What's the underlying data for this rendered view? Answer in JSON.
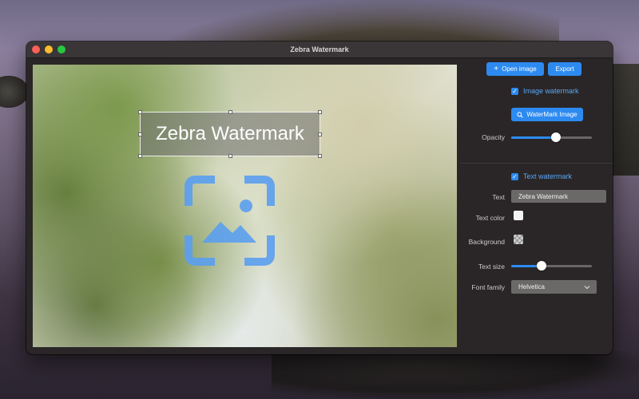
{
  "window": {
    "title": "Zebra Watermark"
  },
  "toolbar": {
    "open_image_label": "Open image",
    "export_label": "Export"
  },
  "image_watermark": {
    "enabled": true,
    "label": "Image watermark",
    "button_label": "WaterMark Image"
  },
  "opacity": {
    "label": "Opacity",
    "value": 0.55
  },
  "text_watermark": {
    "enabled": true,
    "label": "Text watermark",
    "text_label": "Text",
    "text_value": "Zebra Watermark",
    "text_color_label": "Text color",
    "text_color": "#f4f4f4",
    "background_label": "Background",
    "text_size_label": "Text size",
    "text_size": 0.38,
    "font_family_label": "Font family",
    "font_family_value": "Helvetica"
  },
  "canvas": {
    "watermark_text": "Zebra Watermark"
  },
  "colors": {
    "accent": "#2d8af0",
    "window_bg": "#2a2627"
  },
  "icons": {
    "open_image": "plus-icon",
    "watermark_image": "search-icon",
    "font_family": "chevron-down-icon",
    "watermark_placeholder": "image-icon"
  }
}
